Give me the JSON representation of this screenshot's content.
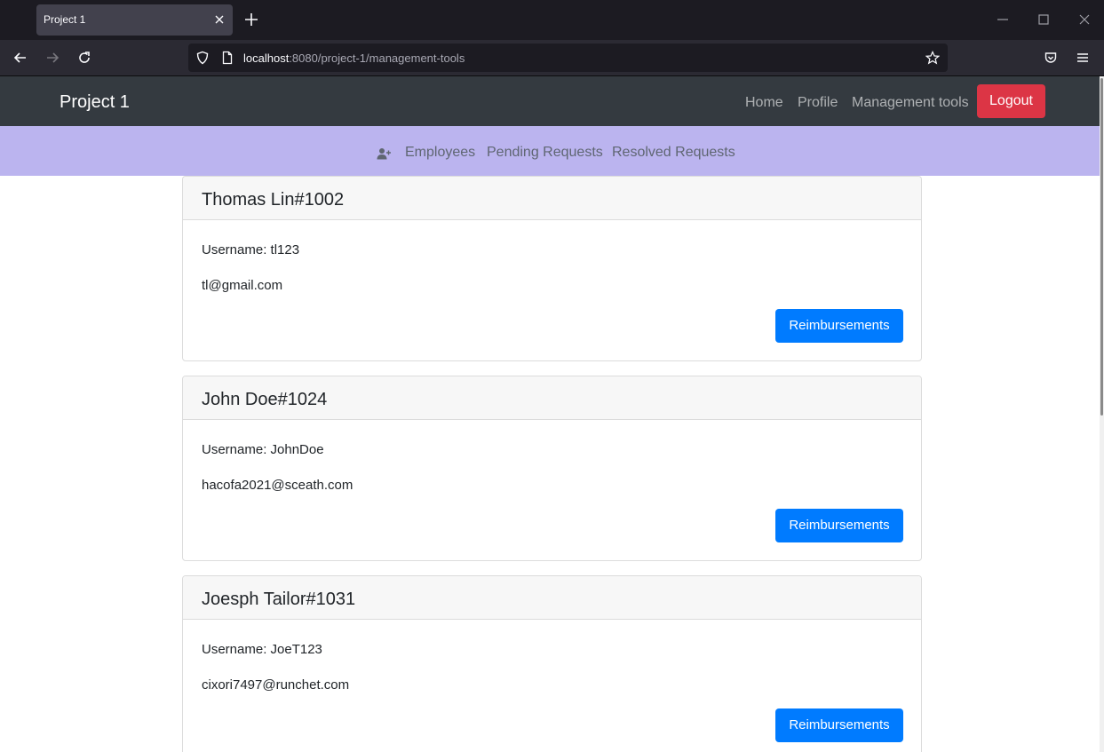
{
  "browser": {
    "tab_title": "Project 1",
    "url_host": "localhost",
    "url_rest": ":8080/project-1/management-tools"
  },
  "navbar": {
    "brand": "Project 1",
    "links": [
      "Home",
      "Profile",
      "Management tools"
    ],
    "logout_label": "Logout"
  },
  "subnav": {
    "icon": "add-user-icon",
    "links": [
      "Employees",
      "Pending Requests",
      "Resolved Requests"
    ]
  },
  "employees": [
    {
      "title": "Thomas Lin#1002",
      "username": "Username: tl123",
      "email": "tl@gmail.com",
      "button": "Reimbursements"
    },
    {
      "title": "John Doe#1024",
      "username": "Username: JohnDoe",
      "email": "hacofa2021@sceath.com",
      "button": "Reimbursements"
    },
    {
      "title": "Joesph Tailor#1031",
      "username": "Username: JoeT123",
      "email": "cixori7497@runchet.com",
      "button": "Reimbursements"
    }
  ],
  "colors": {
    "navbar_bg": "#343a40",
    "subnav_bg": "#bbb4ef",
    "logout": "#dc3545",
    "primary": "#007bff"
  }
}
